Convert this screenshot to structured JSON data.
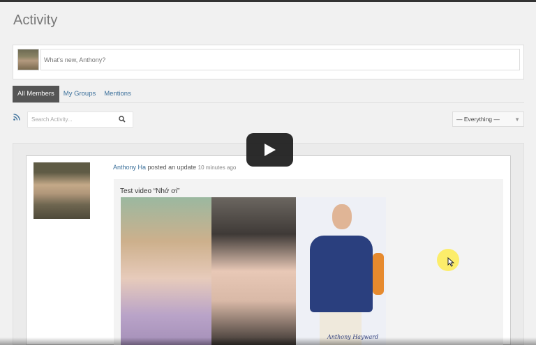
{
  "page": {
    "title": "Activity"
  },
  "whats_new": {
    "placeholder": "What's new, Anthony?"
  },
  "tabs": [
    {
      "label": "All Members",
      "active": true
    },
    {
      "label": "My Groups",
      "active": false
    },
    {
      "label": "Mentions",
      "active": false
    }
  ],
  "search": {
    "placeholder": "Search Activity..."
  },
  "filter": {
    "selected": "— Everything —"
  },
  "activity": {
    "user": "Anthony Ha",
    "action": "posted an update",
    "time": "10 minutes ago",
    "caption": "Test video “Nhớ ơi”",
    "signature": "Anthony Hayward"
  },
  "icons": [
    "rss-icon",
    "search-icon",
    "play-icon",
    "cursor-icon",
    "chevron-down-icon"
  ],
  "colors": {
    "link": "#3a6f9a",
    "tab_active_bg": "#555555",
    "play_bg": "#212121",
    "highlight": "#ffeb3c"
  }
}
